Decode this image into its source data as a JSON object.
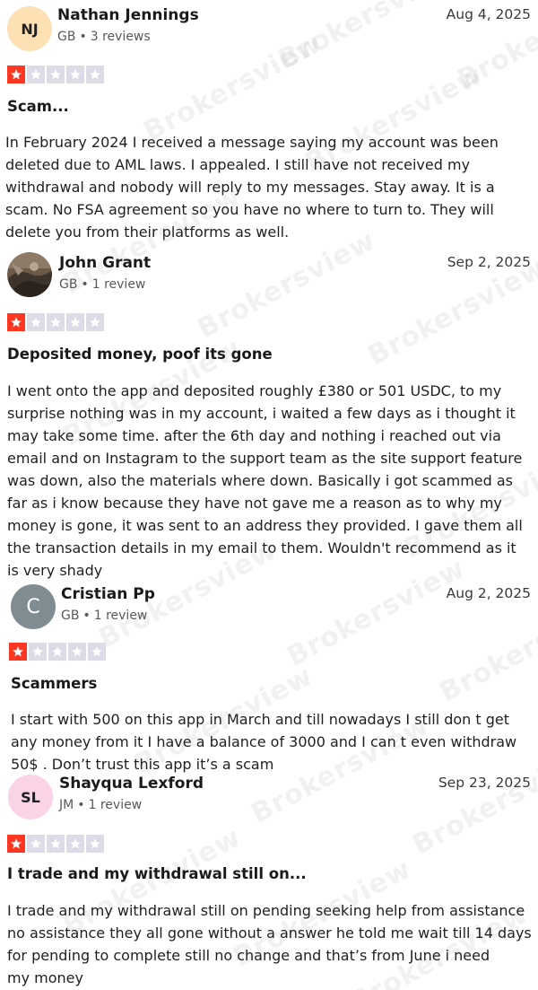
{
  "watermark": "Brokersview",
  "reviews": [
    {
      "initials": "NJ",
      "avatar_color": "#fde0b4",
      "name": "Nathan Jennings",
      "country": "GB",
      "reviews_count": "3 reviews",
      "date": "Aug 4, 2025",
      "rating": 1,
      "title": "Scam...",
      "body_lines": [
        "In February 2024 I received a message saying my account was been",
        "deleted due to AML laws. I appealed. I still have not received my",
        "withdrawal and nobody will reply to my messages. Stay away. It is a",
        "scam. No FSA agreement so you have no where to turn to. They will",
        "delete you from their platforms as well."
      ]
    },
    {
      "initials": "",
      "avatar_type": "photo",
      "name": "John Grant",
      "country": "GB",
      "reviews_count": "1 review",
      "date": "Sep 2, 2025",
      "rating": 1,
      "title": "Deposited money, poof its gone",
      "body_lines": [
        "I went onto the app and deposited roughly £380 or 501 USDC, to my",
        "surprise nothing was in my account, i waited a few days as i thought it",
        "may take some time. after the 6th day and nothing i reached out via",
        "email and on Instagram to the support team as the site support feature",
        "was down, also the materials where down. Basically i got scammed as",
        "far as i know because they have not gave me a reason as to why my",
        "money is gone, it was sent to an address they provided. I gave them all",
        "the transaction details in my email to them. Wouldn't recommend as it",
        "is very shady"
      ]
    },
    {
      "initials": "C",
      "avatar_color": "#7f8c92",
      "name": "Cristian Pp",
      "country": "GB",
      "reviews_count": "1 review",
      "date": "Aug 2, 2025",
      "rating": 1,
      "title": "Scammers",
      "body_lines": [
        "I start with 500 on this app in March and till nowadays I still don t get",
        "any money from it I have a balance of 3000 and I can t even withdraw",
        "50$ . Don’t trust this app it’s a scam"
      ]
    },
    {
      "initials": "SL",
      "avatar_color": "#fbd3e6",
      "name": "Shayqua Lexford",
      "country": "JM",
      "reviews_count": "1 review",
      "date": "Sep 23, 2025",
      "rating": 1,
      "title": "I trade and my withdrawal still on...",
      "body_lines": [
        "I trade and my withdrawal still on pending seeking help from assistance",
        "no assistance they all gone without a answer he told me wait till 14 days",
        "for pending to complete still no change and that’s from June i need",
        "my money"
      ]
    }
  ],
  "colors": {
    "star_filled": "#ff3722",
    "star_empty": "#dcdce6"
  }
}
